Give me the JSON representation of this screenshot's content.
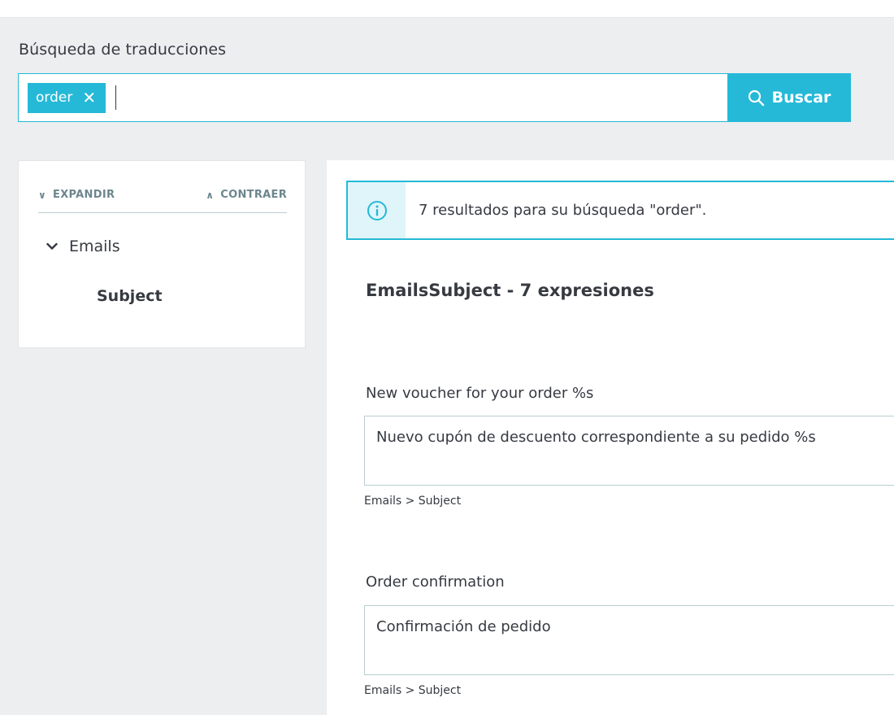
{
  "search": {
    "label": "Búsqueda de traducciones",
    "tag": "order",
    "input_value": "",
    "button_label": "Buscar"
  },
  "tree": {
    "expand_label": "EXPANDIR",
    "collapse_label": "CONTRAER",
    "folder": "Emails",
    "leaf": "Subject"
  },
  "results": {
    "alert_text": "7 resultados para su búsqueda \"order\".",
    "domain_title": "EmailsSubject - 7 expresiones",
    "entries": [
      {
        "source": "New voucher for your order %s",
        "translation": "Nuevo cupón de descuento correspondiente a su pedido %s",
        "path": "Emails > Subject"
      },
      {
        "source": "Order confirmation",
        "translation": "Confirmación de pedido",
        "path": "Emails > Subject"
      }
    ]
  },
  "colors": {
    "accent": "#25b9d7",
    "background": "#eceef0",
    "text": "#363a41",
    "muted": "#6c868e"
  },
  "icons": [
    "search-icon",
    "close-icon",
    "chevron-down-icon",
    "chevron-up-icon",
    "info-icon"
  ]
}
